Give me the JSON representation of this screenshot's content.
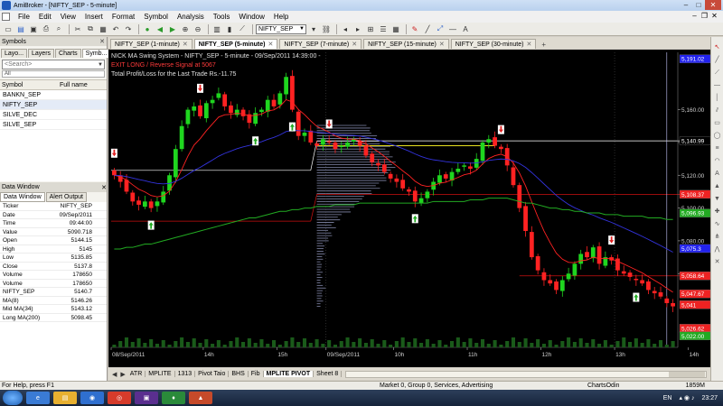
{
  "window": {
    "title": "AmiBroker - [NIFTY_SEP - 5-minute]",
    "controls": [
      "–",
      "□",
      "✕"
    ]
  },
  "menu": [
    "File",
    "Edit",
    "View",
    "Insert",
    "Format",
    "Symbol",
    "Analysis",
    "Tools",
    "Window",
    "Help"
  ],
  "toolbar": {
    "symbol_combo": "NIFTY_SEP"
  },
  "symbols_panel": {
    "header": "Symbols",
    "tabs": [
      "Layo...",
      "Layers",
      "Charts",
      "Symb..."
    ],
    "search_placeholder": "<Search>",
    "filter": "All",
    "col_symbol": "Symbol",
    "col_fullname": "Full name",
    "items": [
      "BANKN_SEP",
      "NIFTY_SEP",
      "SILVE_DEC",
      "SILVE_SEP"
    ]
  },
  "data_window": {
    "header": "Data Window",
    "tabs": [
      "Data Window",
      "Alert Output"
    ],
    "rows": [
      {
        "k": "Ticker",
        "v": "NIFTY_SEP"
      },
      {
        "k": "Date",
        "v": "09/Sep/2011"
      },
      {
        "k": "Time",
        "v": "09:44:00"
      },
      {
        "k": "Value",
        "v": "5090.718"
      },
      {
        "k": "Open",
        "v": "5144.15"
      },
      {
        "k": "High",
        "v": "5145"
      },
      {
        "k": "Low",
        "v": "5135.85"
      },
      {
        "k": "Close",
        "v": "5137.8"
      },
      {
        "k": "Volume",
        "v": "178650"
      },
      {
        "k": "Volume",
        "v": "178650"
      },
      {
        "k": "NIFTY_SEP",
        "v": "5140.7"
      },
      {
        "k": "MA(8)",
        "v": "5146.26"
      },
      {
        "k": "Mid MA(34)",
        "v": "5143.12"
      },
      {
        "k": "Long MA(200)",
        "v": "5098.45"
      }
    ]
  },
  "chart_tabs": [
    {
      "label": "NIFTY_SEP (1-minute)",
      "active": false
    },
    {
      "label": "NIFTY_SEP (5-minute)",
      "active": true
    },
    {
      "label": "NIFTY_SEP (7-minute)",
      "active": false
    },
    {
      "label": "NIFTY_SEP (15-minute)",
      "active": false
    },
    {
      "label": "NIFTY_SEP (30-minute)",
      "active": false
    }
  ],
  "sheet_tabs": [
    {
      "label": "ATR",
      "active": false
    },
    {
      "label": "MPLITE",
      "active": false
    },
    {
      "label": "1313",
      "active": false
    },
    {
      "label": "Pivot Taio",
      "active": false
    },
    {
      "label": "BHS",
      "active": false
    },
    {
      "label": "Fib",
      "active": false
    },
    {
      "label": "MPLITE PIVOT",
      "active": true
    },
    {
      "label": "Sheet 8",
      "active": false
    }
  ],
  "status": {
    "help": "For Help, press F1",
    "market": "Market 0, Group 0, Services, Advertising",
    "charts": "ChartsOdin",
    "memory": "1859M"
  },
  "taskbar": {
    "lang": "EN",
    "time": "23:27"
  },
  "chart_data": {
    "type": "candlestick",
    "header_line": "NICK MA Swing System - NIFTY_SEP - 5-minute - 09/Sep/2011 14:39:00 -",
    "signal_text": "EXIT LONG / Reverse Signal at 5067",
    "pnl_text": "Total Profit/Loss for the Last Trade Rs.-11.75",
    "colors": {
      "up": "#1fd61f",
      "down": "#ff2222",
      "ma_fast": "#ff2222",
      "ma_mid": "#3333dd",
      "ma_long": "#22aa22",
      "profile": "#9aa0c8",
      "poc": "#e8e020"
    },
    "ylim": [
      5015,
      5195
    ],
    "y_ticks": [
      5060,
      5080,
      5100,
      5120,
      5140,
      5160
    ],
    "price_labels": [
      {
        "value": "5,191.02",
        "y": 5191.02,
        "bg": "#2222ee",
        "fg": "#fff"
      },
      {
        "value": "5,140.99",
        "y": 5140.99,
        "bg": "#000",
        "fg": "#fff"
      },
      {
        "value": "5,108.37",
        "y": 5108.37,
        "bg": "#ee2222",
        "fg": "#fff"
      },
      {
        "value": "5,096.93",
        "y": 5096.93,
        "bg": "#22aa22",
        "fg": "#fff"
      },
      {
        "value": "5,075.3",
        "y": 5075.3,
        "bg": "#2222ee",
        "fg": "#fff"
      },
      {
        "value": "5,058.64",
        "y": 5058.64,
        "bg": "#ee2222",
        "fg": "#fff"
      },
      {
        "value": "5,047.67",
        "y": 5047.67,
        "bg": "#ee2222",
        "fg": "#fff"
      },
      {
        "value": "5,041",
        "y": 5041,
        "bg": "#ee2222",
        "fg": "#fff"
      },
      {
        "value": "5,026.62",
        "y": 5026.62,
        "bg": "#ee2222",
        "fg": "#fff"
      },
      {
        "value": "5,022.00",
        "y": 5022.0,
        "bg": "#22aa22",
        "fg": "#fff"
      }
    ],
    "x_labels": [
      {
        "label": "08/Sep/2011",
        "i": 0
      },
      {
        "label": "14h",
        "i": 15
      },
      {
        "label": "15h",
        "i": 27
      },
      {
        "label": "09/Sep/2011",
        "i": 35
      },
      {
        "label": "10h",
        "i": 46
      },
      {
        "label": "11h",
        "i": 58
      },
      {
        "label": "12h",
        "i": 70
      },
      {
        "label": "13h",
        "i": 82
      },
      {
        "label": "14h",
        "i": 94
      },
      {
        "label": "15h",
        "i": 106
      }
    ],
    "closes": [
      5120,
      5116,
      5110,
      5104,
      5102,
      5104,
      5100,
      5104,
      5110,
      5120,
      5136,
      5150,
      5160,
      5162,
      5156,
      5164,
      5166,
      5170,
      5162,
      5158,
      5160,
      5156,
      5152,
      5158,
      5160,
      5166,
      5162,
      5170,
      5180,
      5160,
      5144,
      5146,
      5140,
      5138,
      5142,
      5140,
      5136,
      5138,
      5140,
      5142,
      5138,
      5132,
      5128,
      5126,
      5122,
      5118,
      5116,
      5112,
      5110,
      5104,
      5106,
      5110,
      5116,
      5120,
      5118,
      5122,
      5124,
      5126,
      5124,
      5130,
      5140,
      5142,
      5138,
      5136,
      5126,
      5114,
      5100,
      5086,
      5070,
      5062,
      5056,
      5054,
      5050,
      5056,
      5060,
      5066,
      5072,
      5070,
      5076,
      5066,
      5070,
      5068,
      5062,
      5060,
      5058,
      5056,
      5054,
      5050,
      5048,
      5046,
      5042,
      5040
    ],
    "ma_long": [
      5075,
      5075,
      5076,
      5076,
      5077,
      5078,
      5078,
      5079,
      5080,
      5081,
      5082,
      5083,
      5084,
      5085,
      5086,
      5087,
      5088,
      5089,
      5090,
      5091,
      5092,
      5093,
      5094,
      5094,
      5095,
      5096,
      5097,
      5098,
      5098,
      5099,
      5099,
      5100,
      5100,
      5101,
      5101,
      5101,
      5102,
      5102,
      5102,
      5102,
      5103,
      5103,
      5103,
      5103,
      5103,
      5103,
      5103,
      5103,
      5103,
      5103,
      5103,
      5103,
      5104,
      5104,
      5104,
      5104,
      5104,
      5104,
      5105,
      5105,
      5105,
      5106,
      5106,
      5106,
      5106,
      5105,
      5104,
      5103,
      5103,
      5102,
      5101,
      5100,
      5100,
      5099,
      5099,
      5098,
      5098,
      5097,
      5097,
      5097,
      5096,
      5096,
      5096,
      5095,
      5095,
      5095,
      5095,
      5094,
      5094,
      5094,
      5093,
      5093
    ],
    "buy_signals": [
      6,
      23,
      29,
      49,
      85
    ],
    "sell_signals": [
      0,
      14,
      35,
      63,
      81
    ]
  }
}
